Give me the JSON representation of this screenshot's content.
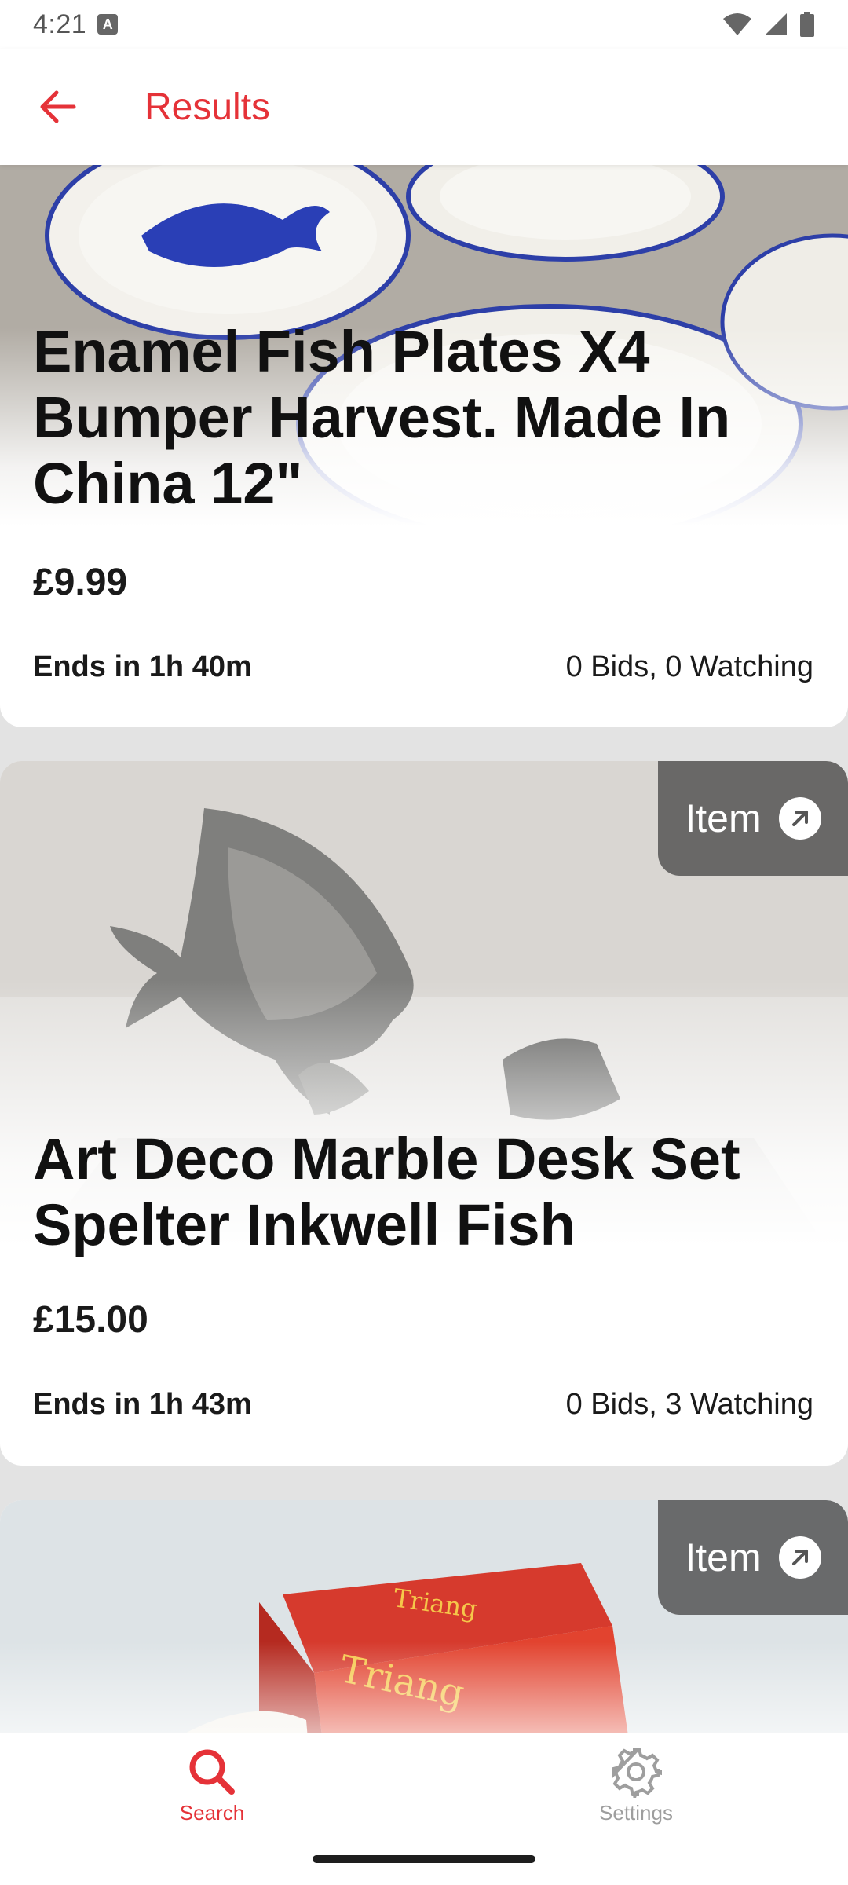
{
  "status_bar": {
    "time": "4:21",
    "notification_glyph": "A"
  },
  "app_bar": {
    "title": "Results",
    "back_icon": "arrow-left-icon"
  },
  "listings": [
    {
      "title": "Enamel Fish Plates X4 Bumper Harvest. Made In China 12\"",
      "price": "£9.99",
      "ends": "Ends in 1h 40m",
      "bids": "0 Bids, 0 Watching"
    },
    {
      "title": "Art Deco Marble Desk Set Spelter Inkwell Fish",
      "price": "£15.00",
      "ends": "Ends in 1h 43m",
      "bids": "0 Bids, 3 Watching",
      "chip_label": "Item"
    },
    {
      "chip_label": "Item"
    }
  ],
  "bottom_nav": [
    {
      "label": "Search",
      "icon": "search-icon",
      "active": true
    },
    {
      "label": "Settings",
      "icon": "gear-icon",
      "active": false
    }
  ],
  "colors": {
    "accent": "#e53238",
    "inactive": "#9e9e9e",
    "background": "#e3e3e3",
    "chip": "#555555"
  }
}
